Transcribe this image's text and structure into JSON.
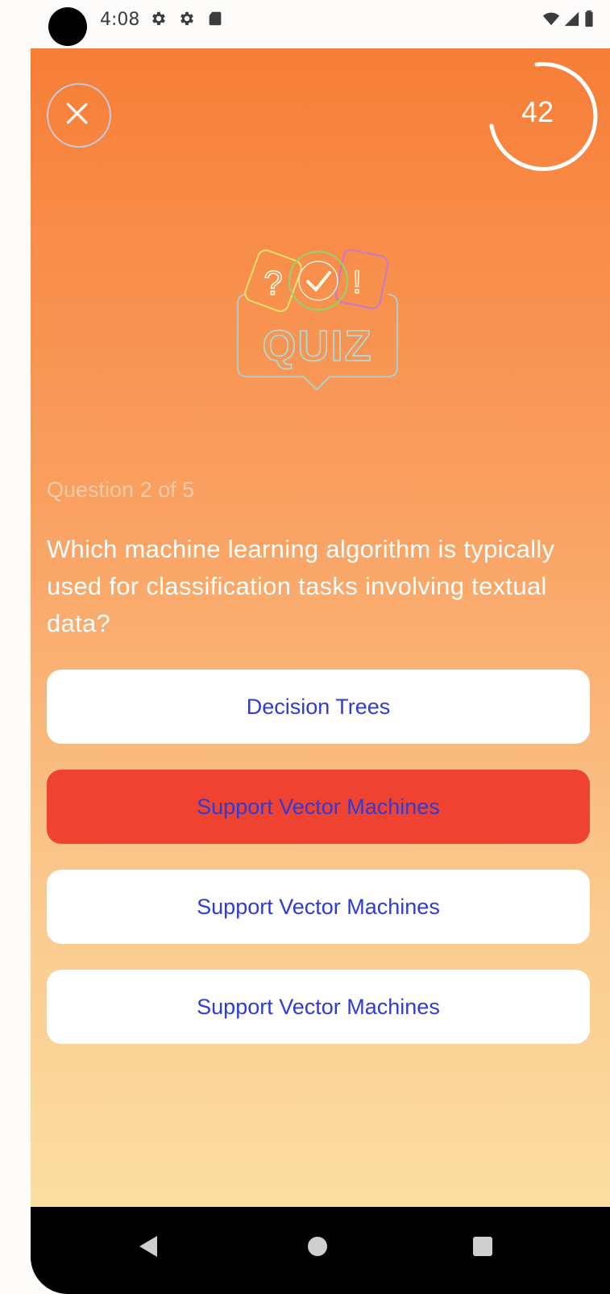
{
  "status_bar": {
    "time": "4:08",
    "icons": [
      "settings-icon",
      "settings-icon",
      "sd-card-icon",
      "wifi-icon",
      "signal-icon",
      "battery-icon"
    ]
  },
  "header": {
    "close_icon": "close-icon",
    "timer": {
      "value": "42"
    }
  },
  "logo": {
    "text": "QUIZ"
  },
  "question": {
    "counter": "Question 2 of 5",
    "text": "Which machine learning algorithm is typically used for classification tasks involving textual data?"
  },
  "answers": [
    {
      "label": "Decision Trees",
      "selected": false
    },
    {
      "label": "Support Vector Machines",
      "selected": true
    },
    {
      "label": "Support Vector Machines",
      "selected": false
    },
    {
      "label": "Support Vector Machines",
      "selected": false
    }
  ],
  "colors": {
    "gradient_top": "#f77e37",
    "gradient_bottom": "#fbe0a3",
    "answer_text": "#2f3bd6",
    "selected_answer": "#f04231"
  },
  "nav_bar": {
    "icons": [
      "back-icon",
      "home-icon",
      "recent-apps-icon"
    ]
  }
}
